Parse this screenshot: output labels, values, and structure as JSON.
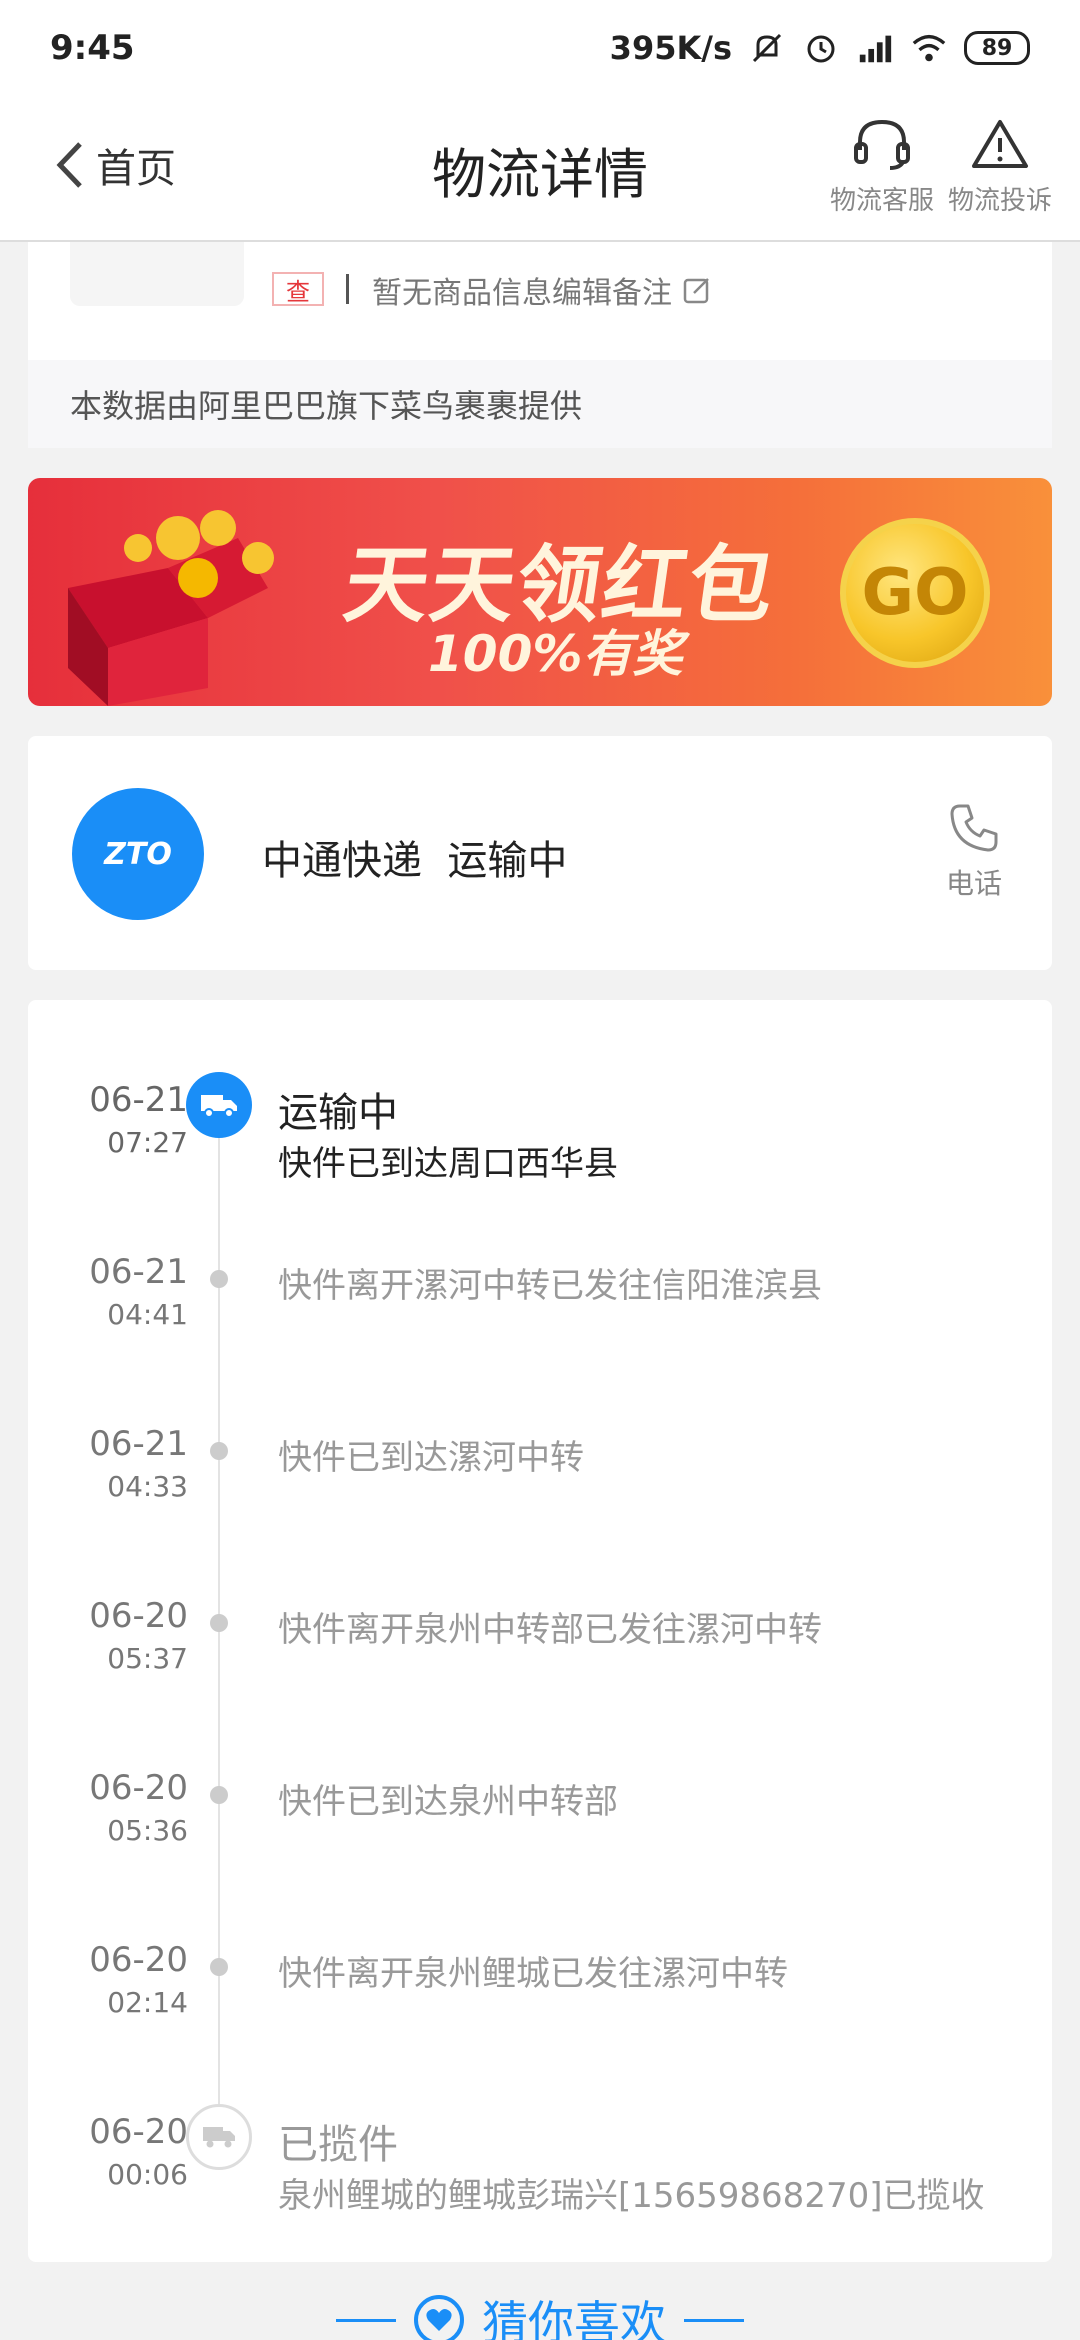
{
  "status_bar": {
    "time": "9:45",
    "speed": "395K/s",
    "battery": "89"
  },
  "header": {
    "back_label": "首页",
    "title": "物流详情",
    "service_label": "物流客服",
    "complaint_label": "物流投诉"
  },
  "product": {
    "tag": "查",
    "note": "暂无商品信息编辑备注",
    "data_source": "本数据由阿里巴巴旗下菜鸟裹裹提供"
  },
  "banner": {
    "title": "天天领红包",
    "subtitle": "100%有奖",
    "go": "GO"
  },
  "carrier": {
    "logo_text": "ZTO",
    "name_status": "中通快递  运输中",
    "phone_label": "电话"
  },
  "tracking": {
    "latest": {
      "date": "06-21",
      "time": "07:27",
      "status": "运输中",
      "desc": "快件已到达周口西华县"
    },
    "events": [
      {
        "date": "06-21",
        "time": "04:41",
        "text": "快件离开漯河中转已发往信阳淮滨县"
      },
      {
        "date": "06-21",
        "time": "04:33",
        "text": "快件已到达漯河中转"
      },
      {
        "date": "06-20",
        "time": "05:37",
        "text": "快件离开泉州中转部已发往漯河中转"
      },
      {
        "date": "06-20",
        "time": "05:36",
        "text": "快件已到达泉州中转部"
      },
      {
        "date": "06-20",
        "time": "02:14",
        "text": "快件离开泉州鲤城已发往漯河中转"
      }
    ],
    "pickup": {
      "date": "06-20",
      "time": "00:06",
      "status": "已揽件",
      "desc": "泉州鲤城的鲤城彭瑞兴[15659868270]已揽收"
    }
  },
  "recommend": {
    "label": "猜你喜欢"
  },
  "colors": {
    "accent": "#1a8ef7",
    "tag_red": "#e5373b"
  }
}
